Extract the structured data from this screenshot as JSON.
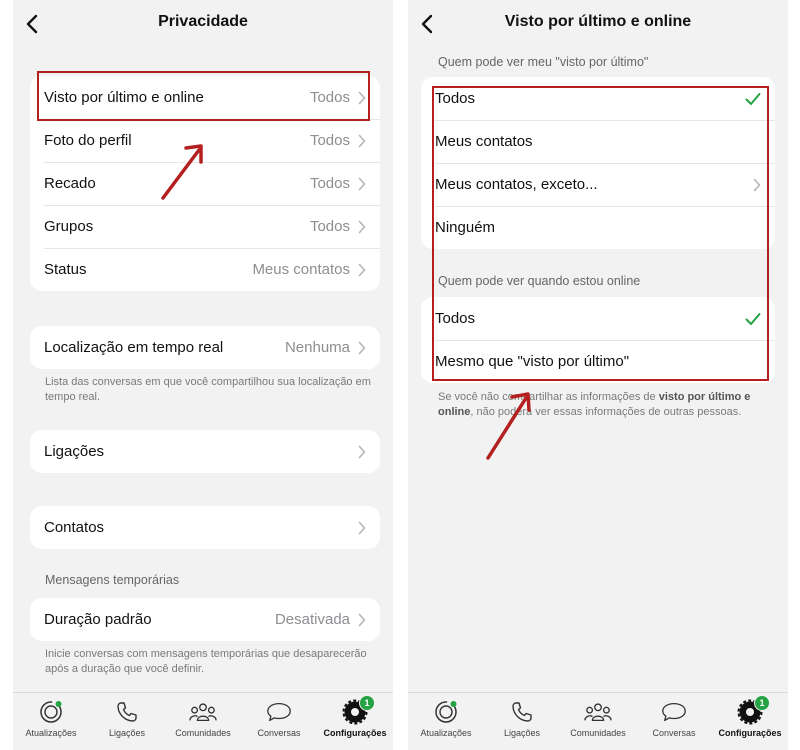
{
  "left": {
    "title": "Privacidade",
    "main_items": [
      {
        "label": "Visto por último e online",
        "value": "Todos"
      },
      {
        "label": "Foto do perfil",
        "value": "Todos"
      },
      {
        "label": "Recado",
        "value": "Todos"
      },
      {
        "label": "Grupos",
        "value": "Todos"
      },
      {
        "label": "Status",
        "value": "Meus contatos"
      }
    ],
    "location": {
      "label": "Localização em tempo real",
      "value": "Nenhuma"
    },
    "location_note": "Lista das conversas em que você compartilhou sua localização em tempo real.",
    "calls_label": "Ligações",
    "contacts_label": "Contatos",
    "temp_section": "Mensagens temporárias",
    "duration": {
      "label": "Duração padrão",
      "value": "Desativada"
    },
    "duration_note": "Inicie conversas com mensagens temporárias que desaparecerão após a duração que você definir."
  },
  "right": {
    "title": "Visto por último e online",
    "last_seen_section": "Quem pode ver meu \"visto por último\"",
    "last_seen_options": [
      "Todos",
      "Meus contatos",
      "Meus contatos, exceto...",
      "Ninguém"
    ],
    "online_section": "Quem pode ver quando estou online",
    "online_options": [
      "Todos",
      "Mesmo que \"visto por último\""
    ],
    "note_part1": "Se você não compartilhar as informações de ",
    "note_bold": "visto por último e online",
    "note_part2": ", não poderá ver essas informações de outras pessoas."
  },
  "tabs": {
    "items": [
      "Atualizações",
      "Ligações",
      "Comunidades",
      "Conversas",
      "Configurações"
    ],
    "badge": "1"
  },
  "colors": {
    "accent_green": "#25a244",
    "highlight_red": "#b3201f"
  }
}
